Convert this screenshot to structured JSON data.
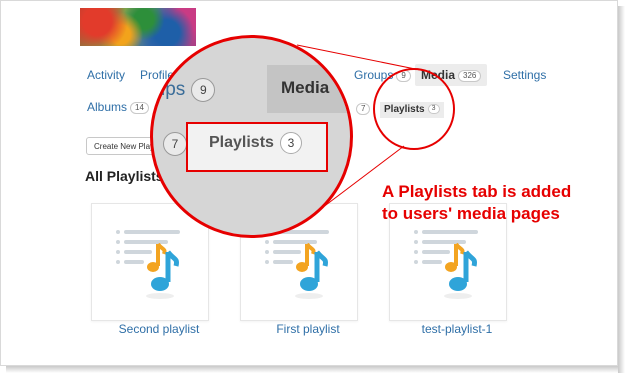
{
  "nav": {
    "items": [
      {
        "label": "Activity",
        "count": ""
      },
      {
        "label": "Profile",
        "count": ""
      },
      {
        "label": "Groups",
        "count": "9"
      },
      {
        "label": "Media",
        "count": "326"
      },
      {
        "label": "Settings",
        "count": ""
      }
    ]
  },
  "subnav": {
    "albums_label": "Albums",
    "albums_count": "14",
    "hidden_count": "7",
    "playlists_label": "Playlists",
    "playlists_count": "3"
  },
  "create_button": "Create New Playlist",
  "section_title": "All Playlists",
  "playlists": [
    {
      "title": "Second playlist"
    },
    {
      "title": "First playlist"
    },
    {
      "title": "test-playlist-1"
    }
  ],
  "magnifier": {
    "groups_label": "Groups",
    "groups_count": "9",
    "media_label": "Media",
    "side_count": "7",
    "playlists_label": "Playlists",
    "playlists_count": "3"
  },
  "annotation": {
    "line1": "A Playlists tab is added",
    "line2": "to users' media pages"
  },
  "colors": {
    "accent_red": "#e60000",
    "link_blue": "#2f6fa7",
    "note_orange": "#f3a421",
    "note_blue": "#2fa4d9"
  }
}
